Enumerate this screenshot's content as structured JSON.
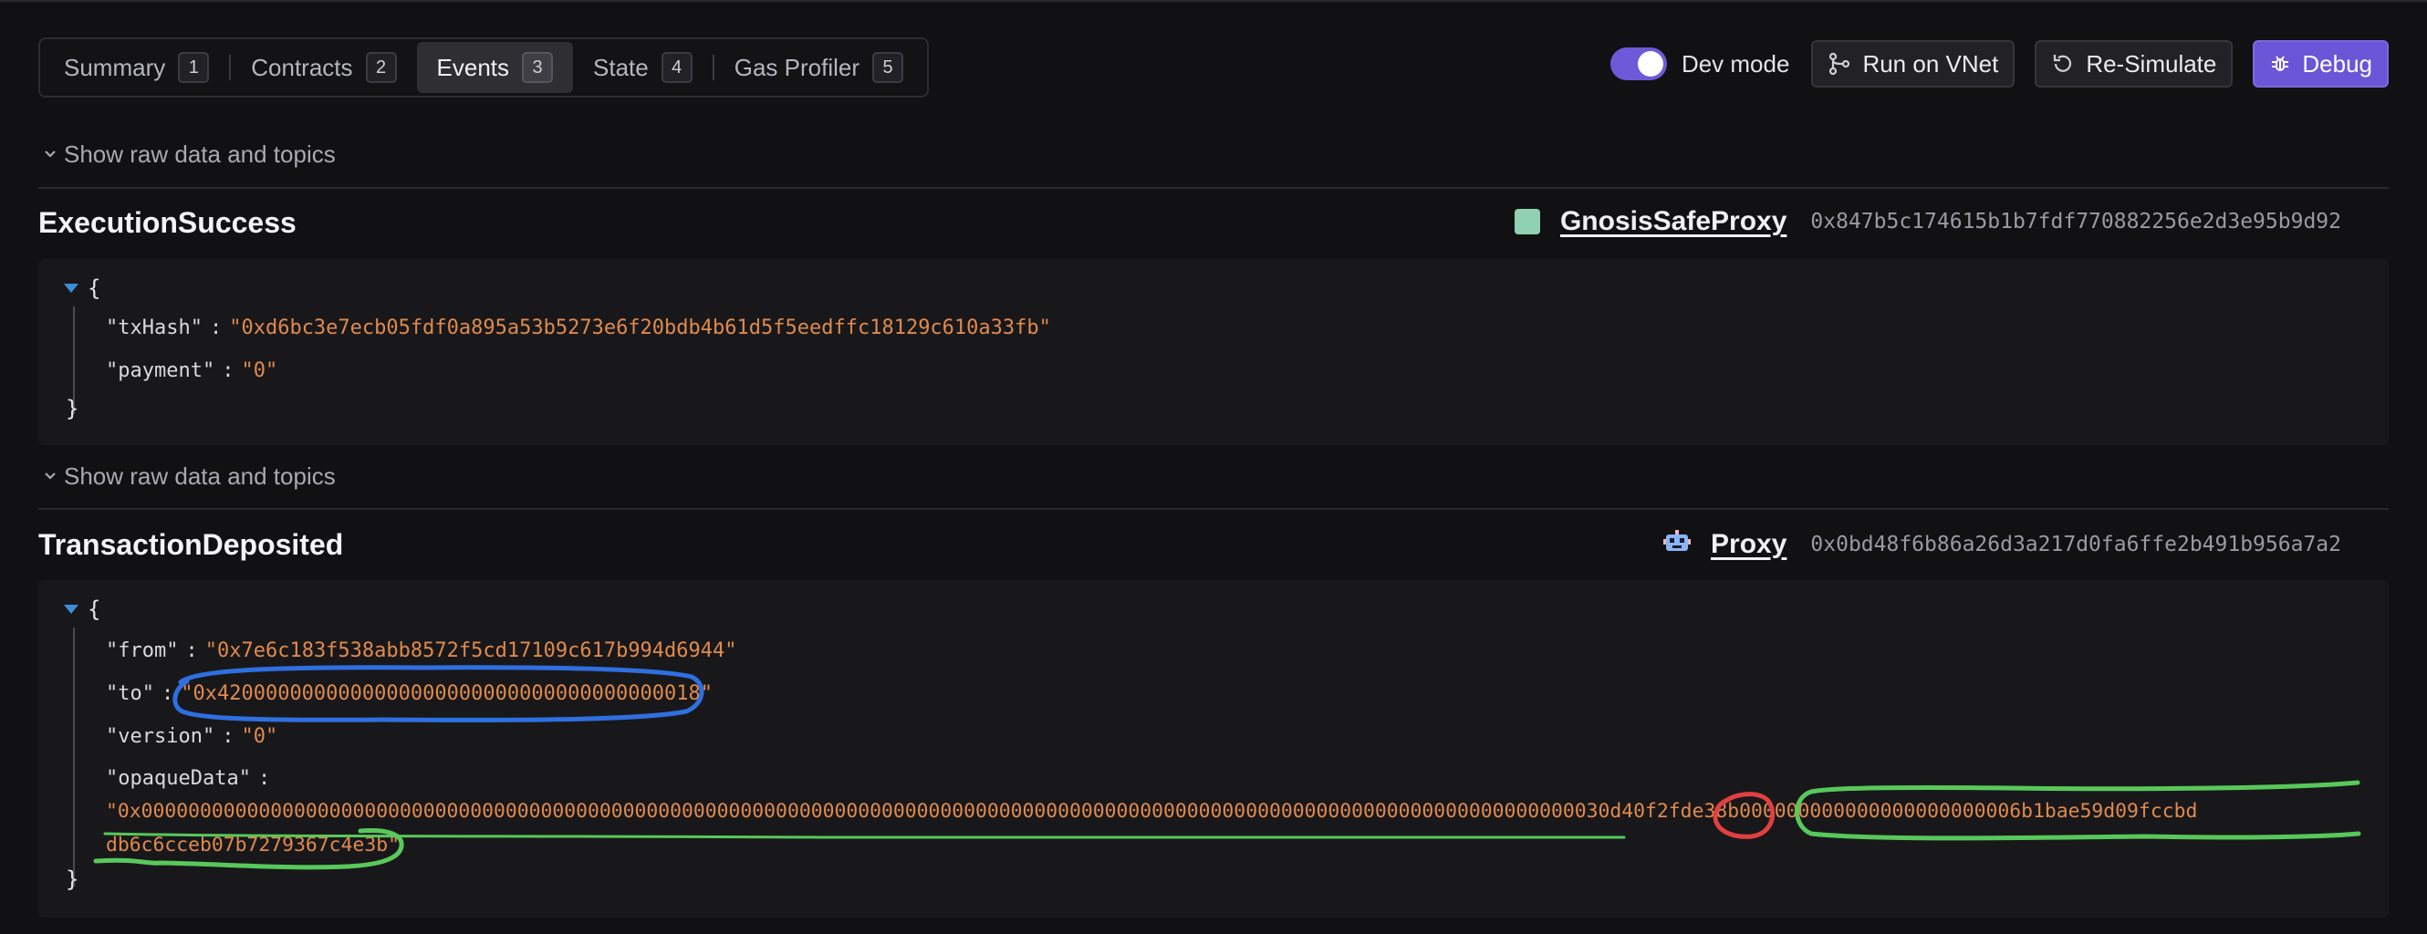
{
  "tabs": [
    {
      "label": "Summary",
      "count": "1"
    },
    {
      "label": "Contracts",
      "count": "2"
    },
    {
      "label": "Events",
      "count": "3"
    },
    {
      "label": "State",
      "count": "4"
    },
    {
      "label": "Gas Profiler",
      "count": "5"
    }
  ],
  "active_tab": "Events",
  "toolbar": {
    "dev_mode_label": "Dev mode",
    "dev_mode_on": true,
    "run_vnet_label": "Run on VNet",
    "resimulate_label": "Re-Simulate",
    "debug_label": "Debug"
  },
  "show_raw_label": "Show raw data and topics",
  "events": [
    {
      "name": "ExecutionSuccess",
      "contract_name": "GnosisSafeProxy",
      "contract_address": "0x847b5c174615b1b7fdf770882256e2d3e95b9d92",
      "contract_icon": "square-swatch",
      "params": [
        {
          "key": "\"txHash\"",
          "value": "\"0xd6bc3e7ecb05fdf0a895a53b5273e6f20bdb4b61d5f5eedffc18129c610a33fb\""
        },
        {
          "key": "\"payment\"",
          "value": "\"0\""
        }
      ]
    },
    {
      "name": "TransactionDeposited",
      "contract_name": "Proxy",
      "contract_address": "0x0bd48f6b86a26d3a217d0fa6ffe2b491b956a7a2",
      "contract_icon": "robot-avatar-icon",
      "params": [
        {
          "key": "\"from\"",
          "value": "\"0x7e6c183f538abb8572f5cd17109c617b994d6944\""
        },
        {
          "key": "\"to\"",
          "value": "\"0x4200000000000000000000000000000000000018\""
        },
        {
          "key": "\"version\"",
          "value": "\"0\""
        },
        {
          "key": "\"opaqueData\"",
          "value_line1": "\"0x00000000000000000000000000000000000000000000000000000000000000000000000000000000000000000000000000000000000000000000000000030d40f2fde38b000000000000000000000006b1bae59d09fccbd",
          "value_line2": "db6c6cceb07b7279367c4e3b\""
        }
      ]
    }
  ],
  "annotations": {
    "blue_color": "#2f6fe0",
    "red_color": "#e0403f",
    "green_color": "#58c85a"
  }
}
